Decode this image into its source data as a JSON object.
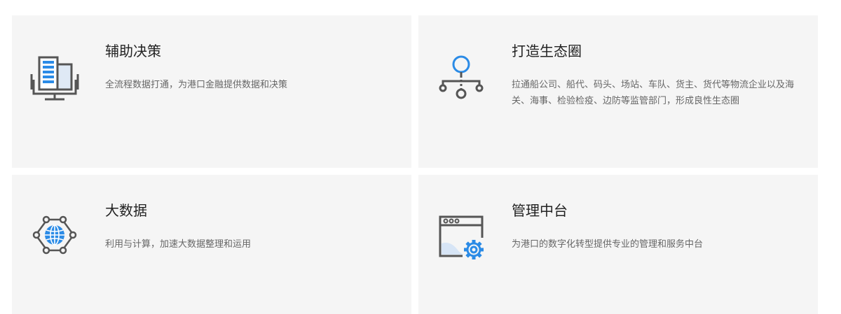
{
  "cards": [
    {
      "title": "辅助决策",
      "desc": "全流程数据打通，为港口金融提供数据和决策",
      "icon": "building-icon"
    },
    {
      "title": "打造生态圈",
      "desc": "拉通船公司、船代、码头、场站、车队、货主、货代等物流企业以及海关、海事、检验检疫、边防等监管部门，形成良性生态圈",
      "icon": "network-hierarchy-icon"
    },
    {
      "title": "大数据",
      "desc": "利用与计算，加速大数据整理和运用",
      "icon": "globe-network-icon"
    },
    {
      "title": "管理中台",
      "desc": "为港口的数字化转型提供专业的管理和服务中台",
      "icon": "browser-settings-icon"
    }
  ],
  "colors": {
    "card_bg": "#f5f5f5",
    "icon_gray": "#555555",
    "icon_blue": "#2b8be6",
    "title": "#222222",
    "desc": "#666666"
  }
}
